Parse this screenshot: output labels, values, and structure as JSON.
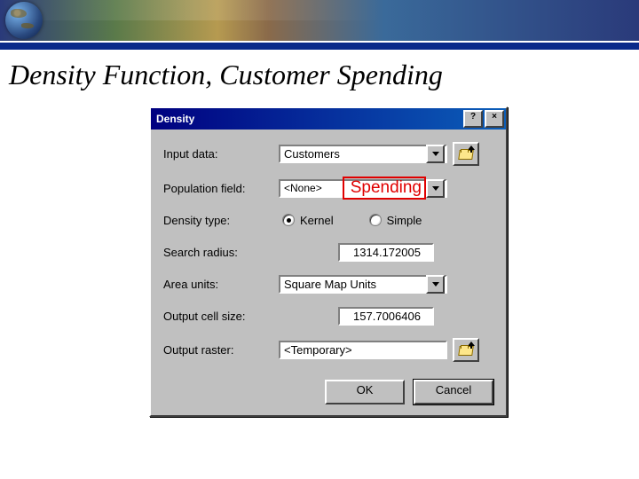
{
  "slide": {
    "title": "Density Function, Customer Spending"
  },
  "dialog": {
    "title": "Density",
    "labels": {
      "input_data": "Input data:",
      "population_field": "Population field:",
      "density_type": "Density type:",
      "search_radius": "Search radius:",
      "area_units": "Area units:",
      "output_cell_size": "Output cell size:",
      "output_raster": "Output raster:"
    },
    "values": {
      "input_data": "Customers",
      "population_field": "<None>",
      "density_kernel": "Kernel",
      "density_simple": "Simple",
      "search_radius": "1314.172005",
      "area_units": "Square Map Units",
      "output_cell_size": "157.7006406",
      "output_raster": "<Temporary>"
    },
    "buttons": {
      "ok": "OK",
      "cancel": "Cancel",
      "help": "?",
      "close": "×"
    }
  },
  "annotation": {
    "spending": "Spending"
  }
}
